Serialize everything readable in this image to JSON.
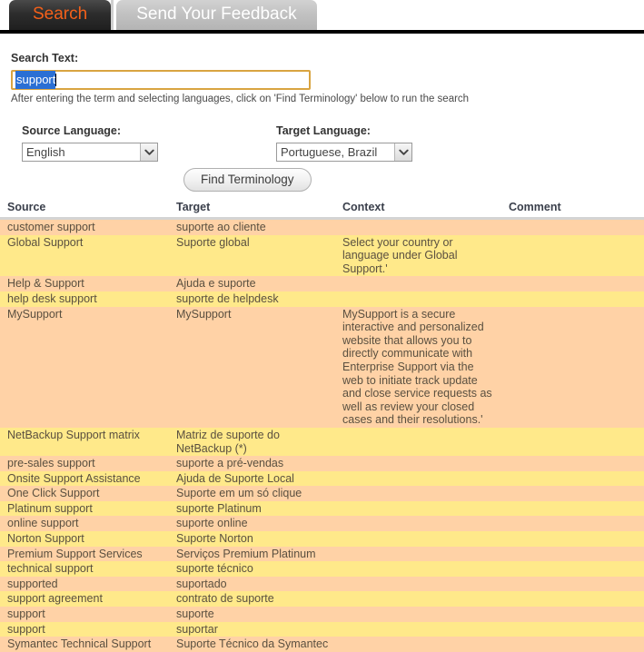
{
  "tabs": [
    {
      "label": "Search",
      "active": true
    },
    {
      "label": "Send Your Feedback",
      "active": false
    }
  ],
  "search": {
    "label": "Search Text:",
    "value": "support",
    "hint": "After entering the term and selecting languages, click on 'Find Terminology' below to run the search"
  },
  "source_language": {
    "label": "Source Language:",
    "value": "English"
  },
  "target_language": {
    "label": "Target Language:",
    "value": "Portuguese, Brazil"
  },
  "find_button": {
    "label": "Find Terminology"
  },
  "results": {
    "columns": [
      "Source",
      "Target",
      "Context",
      "Comment"
    ],
    "rows": [
      {
        "source": "customer support",
        "target": "suporte ao cliente",
        "context": "",
        "comment": ""
      },
      {
        "source": "Global Support",
        "target": "Suporte global",
        "context": "Select your country or language under Global Support.'",
        "comment": ""
      },
      {
        "source": "Help & Support",
        "target": "Ajuda e suporte",
        "context": "",
        "comment": ""
      },
      {
        "source": "help desk support",
        "target": "suporte de helpdesk",
        "context": "",
        "comment": ""
      },
      {
        "source": "MySupport",
        "target": "MySupport",
        "context": "MySupport is a secure interactive and personalized website that allows you to directly communicate with Enterprise Support via the web to initiate track update and close service requests as well as review your closed cases and their resolutions.'",
        "comment": ""
      },
      {
        "source": "NetBackup Support matrix",
        "target": "Matriz de suporte do NetBackup (*)",
        "context": "",
        "comment": ""
      },
      {
        "source": "pre-sales support",
        "target": "suporte a pré-vendas",
        "context": "",
        "comment": ""
      },
      {
        "source": "Onsite Support Assistance",
        "target": "Ajuda de Suporte Local",
        "context": "",
        "comment": ""
      },
      {
        "source": "One Click Support",
        "target": "Suporte em um só clique",
        "context": "",
        "comment": ""
      },
      {
        "source": "Platinum support",
        "target": "suporte Platinum",
        "context": "",
        "comment": ""
      },
      {
        "source": "online support",
        "target": "suporte online",
        "context": "",
        "comment": ""
      },
      {
        "source": "Norton Support",
        "target": "Suporte Norton",
        "context": "",
        "comment": ""
      },
      {
        "source": "Premium Support Services",
        "target": "Serviços Premium Platinum",
        "context": "",
        "comment": ""
      },
      {
        "source": "technical support",
        "target": "suporte técnico",
        "context": "",
        "comment": ""
      },
      {
        "source": "supported",
        "target": "suportado",
        "context": "",
        "comment": ""
      },
      {
        "source": "support agreement",
        "target": "contrato de suporte",
        "context": "",
        "comment": ""
      },
      {
        "source": "support",
        "target": "suporte",
        "context": "",
        "comment": ""
      },
      {
        "source": "support",
        "target": "suportar",
        "context": "",
        "comment": ""
      },
      {
        "source": "Symantec Technical Support",
        "target": "Suporte Técnico da Symantec",
        "context": "",
        "comment": ""
      }
    ]
  },
  "colors": {
    "tab_active_text": "#f4601a",
    "row_peach": "#ffd2a6",
    "row_yellow": "#ffe98a",
    "input_focus_border": "#d9a441",
    "selection_highlight": "#2a6fd4"
  }
}
